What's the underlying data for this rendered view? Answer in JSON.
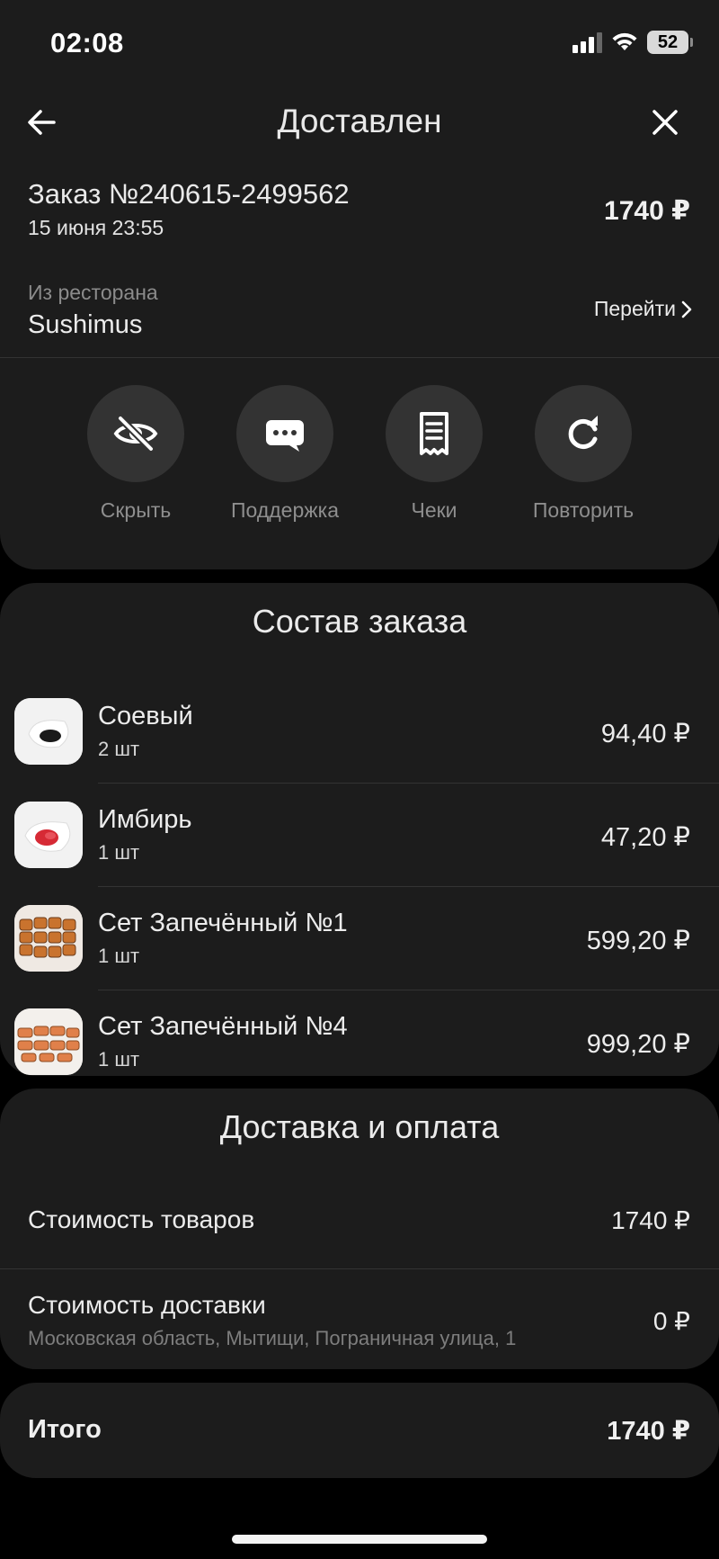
{
  "status_bar": {
    "time": "02:08",
    "battery": "52"
  },
  "header": {
    "title": "Доставлен"
  },
  "order": {
    "number": "Заказ №240615-2499562",
    "date": "15 июня 23:55",
    "total": "1740 ₽"
  },
  "restaurant": {
    "caption": "Из ресторана",
    "name": "Sushimus",
    "link_label": "Перейти"
  },
  "actions": [
    {
      "label": "Скрыть",
      "icon": "eye-off-icon"
    },
    {
      "label": "Поддержка",
      "icon": "chat-bubble-icon"
    },
    {
      "label": "Чеки",
      "icon": "receipt-icon"
    },
    {
      "label": "Повторить",
      "icon": "repeat-icon"
    }
  ],
  "order_items": {
    "title": "Состав заказа",
    "items": [
      {
        "name": "Соевый",
        "qty": "2 шт",
        "price": "94,40 ₽"
      },
      {
        "name": "Имбирь",
        "qty": "1 шт",
        "price": "47,20 ₽"
      },
      {
        "name": "Сет Запечённый №1",
        "qty": "1 шт",
        "price": "599,20 ₽"
      },
      {
        "name": "Сет Запечённый №4",
        "qty": "1 шт",
        "price": "999,20 ₽"
      }
    ]
  },
  "payment": {
    "title": "Доставка и оплата",
    "goods_label": "Стоимость товаров",
    "goods_value": "1740 ₽",
    "delivery_label": "Стоимость доставки",
    "delivery_address": "Московская область, Мытищи, Пограничная улица, 1",
    "delivery_value": "0 ₽"
  },
  "total": {
    "label": "Итого",
    "value": "1740 ₽"
  },
  "colors": {
    "background": "#000000",
    "card": "#1c1c1c",
    "circle": "#333333",
    "muted_text": "#8e8e8e"
  }
}
